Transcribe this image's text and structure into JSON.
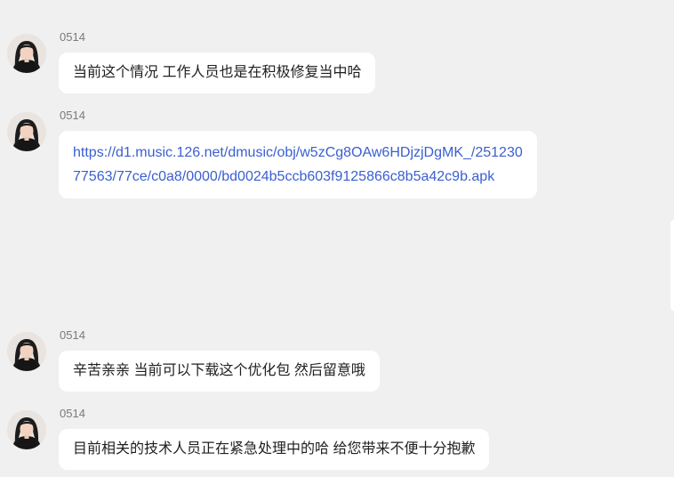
{
  "messages": [
    {
      "sender": "0514",
      "text": "当前这个情况  工作人员也是在积极修复当中哈"
    },
    {
      "sender": "0514",
      "link_line1": "https://d1.music.126.net/dmusic/obj/w5zCg8OAw6HDjzjDgMK_/251230",
      "link_line2": "77563/77ce/c0a8/0000/bd0024b5ccb603f9125866c8b5a42c9b.apk"
    },
    {
      "sender": "0514",
      "text": "辛苦亲亲 当前可以下载这个优化包 然后留意哦"
    },
    {
      "sender": "0514",
      "text": "目前相关的技术人员正在紧急处理中的哈 给您带来不便十分抱歉"
    }
  ],
  "colors": {
    "background": "#f0f0f0",
    "bubble": "#ffffff",
    "link": "#3a5fd0",
    "sender": "#7a7a7a"
  },
  "icons": {
    "avatar": "user-avatar-photo"
  }
}
